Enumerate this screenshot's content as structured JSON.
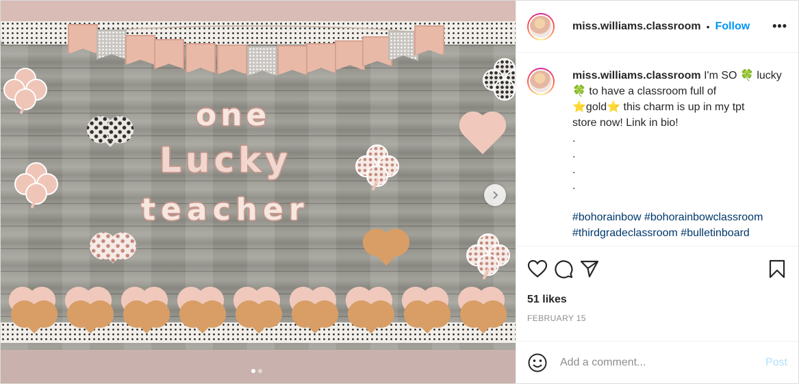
{
  "header": {
    "username": "miss.williams.classroom",
    "separator": "•",
    "follow_label": "Follow",
    "more_label": "•••"
  },
  "caption": {
    "username": "miss.williams.classroom",
    "line1": "I'm SO 🍀 lucky",
    "line2": "🍀 to have a classroom full of",
    "line3": "⭐gold⭐ this charm is up in my tpt",
    "line4": "store now! Link in bio!",
    "dots": [
      ".",
      ".",
      ".",
      "."
    ],
    "hashtags_line1": "#bohorainbow #bohorainbowclassroom",
    "hashtags_line2": "#thirdgradeclassroom #bulletinboard"
  },
  "media": {
    "board_words": [
      "one",
      "Lucky",
      "teacher"
    ],
    "next_icon": "chevron-right-icon",
    "carousel": {
      "current": 1,
      "total": 2
    }
  },
  "actions": {
    "icons": [
      "heart-icon",
      "comment-icon",
      "share-icon",
      "bookmark-icon"
    ]
  },
  "likes": "51 likes",
  "date": "FEBRUARY 15",
  "comment": {
    "placeholder": "Add a comment...",
    "post_label": "Post"
  },
  "colors": {
    "link": "#0095f6",
    "hashtag": "#00376b",
    "post_disabled": "#b2dffc",
    "muted": "#8e8e8e"
  }
}
